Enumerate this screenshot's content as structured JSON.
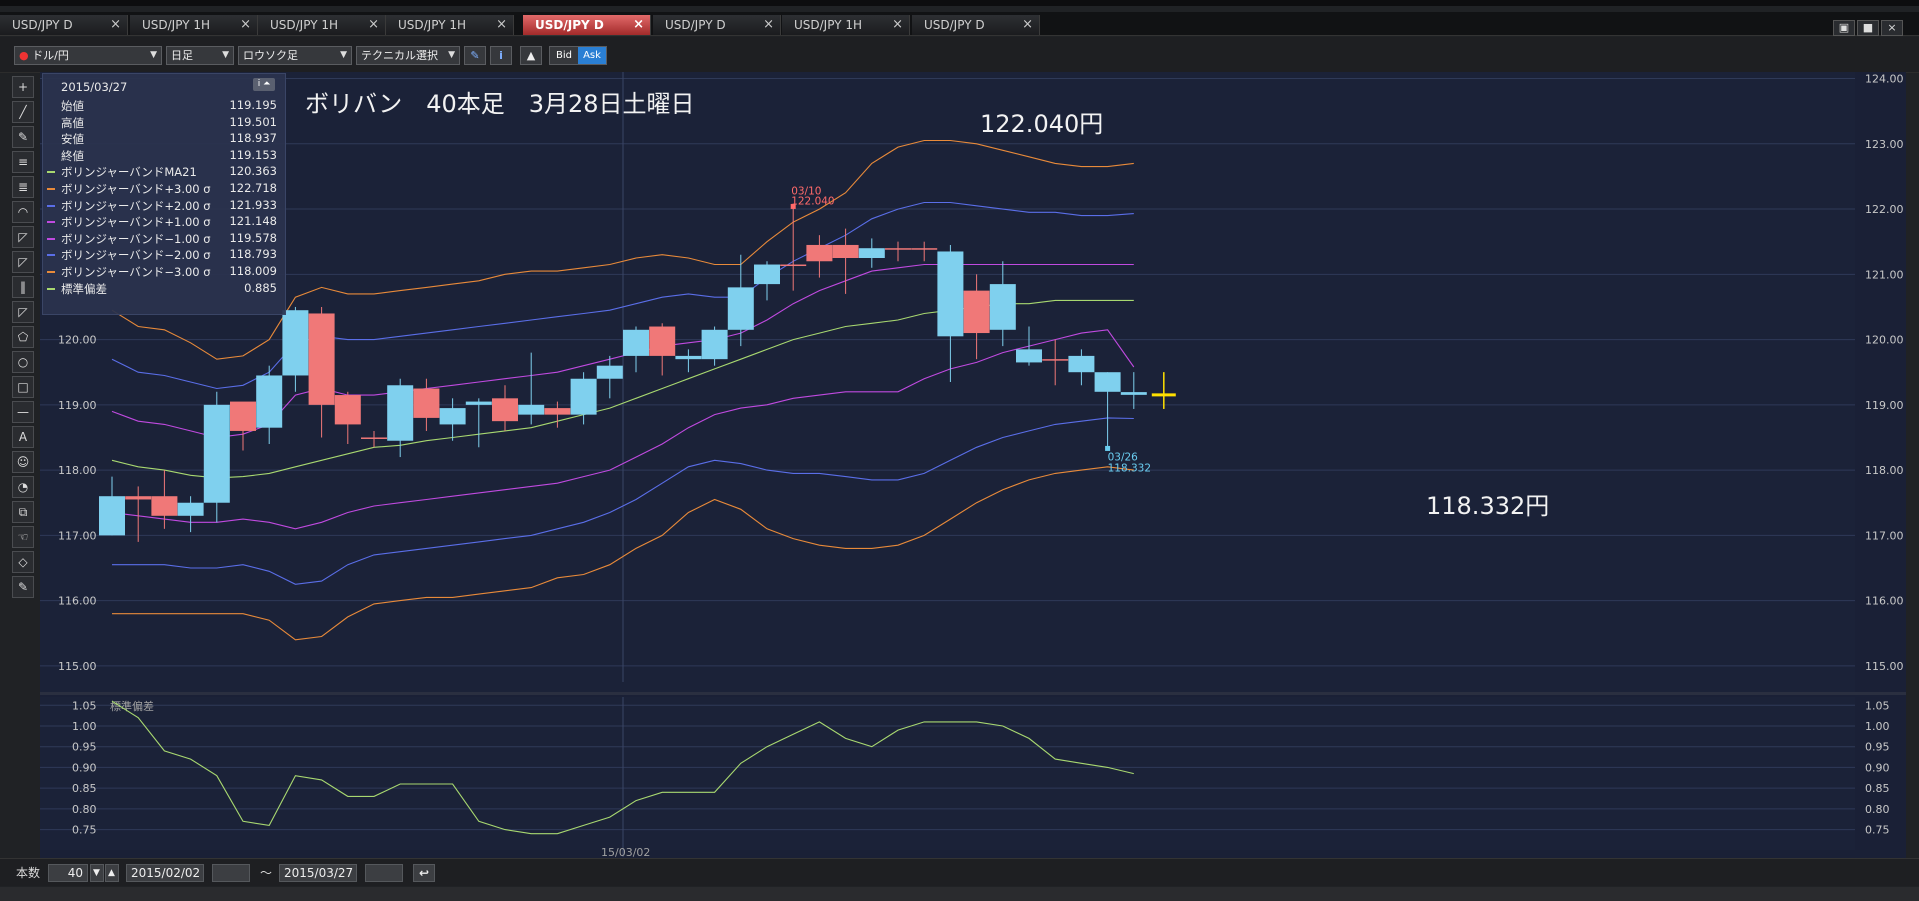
{
  "tabs": [
    {
      "label": "USD/JPY D",
      "active": false
    },
    {
      "label": "USD/JPY 1H",
      "active": false
    },
    {
      "label": "USD/JPY 1H",
      "active": false
    },
    {
      "label": "USD/JPY 1H",
      "active": false
    },
    {
      "label": "USD/JPY D",
      "active": true
    },
    {
      "label": "USD/JPY D",
      "active": false
    },
    {
      "label": "USD/JPY 1H",
      "active": false
    },
    {
      "label": "USD/JPY D",
      "active": false
    }
  ],
  "tab_close_symbol": "×",
  "window_buttons": [
    "▣",
    "■",
    "×"
  ],
  "toolbar": {
    "currency_pair": "ドル/円",
    "timeframe": "日足",
    "chart_style": "ロウソク足",
    "technical_select": "テクニカル選択",
    "bid_label": "Bid",
    "ask_label": "Ask",
    "pencil_icon": "✎",
    "info_icon": "i",
    "mountain_icon": "▲"
  },
  "left_tools": [
    "+",
    "╱",
    "✎",
    "≡",
    "≣",
    "◠",
    "◸",
    "◸",
    "‖",
    "◸",
    "⬠",
    "○",
    "□",
    "—",
    "A",
    "☺",
    "◔",
    "⧉",
    "☜",
    "◇",
    "✎"
  ],
  "info_panel": {
    "date": "2015/03/27",
    "button": "i ⏶",
    "rows": [
      {
        "label": "始値",
        "value": "119.195",
        "color": ""
      },
      {
        "label": "高値",
        "value": "119.501",
        "color": ""
      },
      {
        "label": "安値",
        "value": "118.937",
        "color": ""
      },
      {
        "label": "終値",
        "value": "119.153",
        "color": ""
      },
      {
        "label": "ボリンジャーバンドMA21",
        "value": "120.363",
        "color": "#a8d870"
      },
      {
        "label": "ボリンジャーバンド+3.00 σ",
        "value": "122.718",
        "color": "#e88a3a"
      },
      {
        "label": "ボリンジャーバンド+2.00 σ",
        "value": "121.933",
        "color": "#5a6ee8"
      },
      {
        "label": "ボリンジャーバンド+1.00 σ",
        "value": "121.148",
        "color": "#c04ae0"
      },
      {
        "label": "ボリンジャーバンド−1.00 σ",
        "value": "119.578",
        "color": "#c04ae0"
      },
      {
        "label": "ボリンジャーバンド−2.00 σ",
        "value": "118.793",
        "color": "#5a6ee8"
      },
      {
        "label": "ボリンジャーバンド−3.00 σ",
        "value": "118.009",
        "color": "#e88a3a"
      },
      {
        "label": "標準偏差",
        "value": "0.885",
        "color": "#a8d870"
      }
    ]
  },
  "chart_data": {
    "type": "candlestick",
    "title": "ボリバン　40本足　3月28日土曜日",
    "ylim": [
      114.6,
      124.1
    ],
    "yticks": [
      "124.00",
      "123.00",
      "122.00",
      "121.00",
      "120.00",
      "119.00",
      "118.00",
      "117.00",
      "116.00",
      "115.00"
    ],
    "candles": [
      {
        "o": 117.6,
        "h": 117.9,
        "l": 117.0,
        "c": 117.0
      },
      {
        "o": 117.55,
        "h": 117.75,
        "l": 116.9,
        "c": 117.6
      },
      {
        "o": 117.3,
        "h": 118.0,
        "l": 117.1,
        "c": 117.6
      },
      {
        "o": 117.5,
        "h": 117.6,
        "l": 117.05,
        "c": 117.3
      },
      {
        "o": 119.0,
        "h": 119.2,
        "l": 117.2,
        "c": 117.5
      },
      {
        "o": 118.6,
        "h": 119.0,
        "l": 118.3,
        "c": 119.05
      },
      {
        "o": 119.45,
        "h": 119.6,
        "l": 118.4,
        "c": 118.65
      },
      {
        "o": 120.45,
        "h": 120.5,
        "l": 119.2,
        "c": 119.45
      },
      {
        "o": 119.0,
        "h": 120.5,
        "l": 118.5,
        "c": 120.4
      },
      {
        "o": 118.7,
        "h": 119.2,
        "l": 118.4,
        "c": 119.15
      },
      {
        "o": 118.5,
        "h": 118.6,
        "l": 118.35,
        "c": 118.5
      },
      {
        "o": 119.3,
        "h": 119.4,
        "l": 118.2,
        "c": 118.45
      },
      {
        "o": 118.8,
        "h": 119.4,
        "l": 118.6,
        "c": 119.25
      },
      {
        "o": 118.95,
        "h": 119.1,
        "l": 118.45,
        "c": 118.7
      },
      {
        "o": 119.05,
        "h": 119.1,
        "l": 118.35,
        "c": 119.0
      },
      {
        "o": 118.75,
        "h": 119.3,
        "l": 118.6,
        "c": 119.1
      },
      {
        "o": 119.0,
        "h": 119.8,
        "l": 118.7,
        "c": 118.85
      },
      {
        "o": 118.85,
        "h": 119.05,
        "l": 118.65,
        "c": 118.95
      },
      {
        "o": 119.4,
        "h": 119.5,
        "l": 118.7,
        "c": 118.85
      },
      {
        "o": 119.6,
        "h": 119.75,
        "l": 119.1,
        "c": 119.4
      },
      {
        "o": 120.15,
        "h": 120.2,
        "l": 119.5,
        "c": 119.75
      },
      {
        "o": 119.75,
        "h": 120.25,
        "l": 119.45,
        "c": 120.2
      },
      {
        "o": 119.75,
        "h": 119.85,
        "l": 119.5,
        "c": 119.7
      },
      {
        "o": 120.15,
        "h": 120.2,
        "l": 119.6,
        "c": 119.7
      },
      {
        "o": 120.8,
        "h": 121.3,
        "l": 119.9,
        "c": 120.15
      },
      {
        "o": 121.15,
        "h": 121.2,
        "l": 120.6,
        "c": 120.85
      },
      {
        "o": 121.15,
        "h": 122.04,
        "l": 120.75,
        "c": 121.15
      },
      {
        "o": 121.2,
        "h": 121.6,
        "l": 120.95,
        "c": 121.45
      },
      {
        "o": 121.25,
        "h": 121.7,
        "l": 120.7,
        "c": 121.45
      },
      {
        "o": 121.4,
        "h": 121.55,
        "l": 121.1,
        "c": 121.25
      },
      {
        "o": 121.4,
        "h": 121.5,
        "l": 121.2,
        "c": 121.4
      },
      {
        "o": 121.4,
        "h": 121.5,
        "l": 121.2,
        "c": 121.4
      },
      {
        "o": 121.35,
        "h": 121.45,
        "l": 119.35,
        "c": 120.05
      },
      {
        "o": 120.1,
        "h": 121.0,
        "l": 119.7,
        "c": 120.75
      },
      {
        "o": 120.85,
        "h": 121.2,
        "l": 119.9,
        "c": 120.15
      },
      {
        "o": 119.85,
        "h": 120.2,
        "l": 119.6,
        "c": 119.65
      },
      {
        "o": 119.7,
        "h": 120.0,
        "l": 119.3,
        "c": 119.7
      },
      {
        "o": 119.75,
        "h": 119.85,
        "l": 119.3,
        "c": 119.5
      },
      {
        "o": 119.5,
        "h": 119.5,
        "l": 118.332,
        "c": 119.2
      },
      {
        "o": 119.195,
        "h": 119.501,
        "l": 118.937,
        "c": 119.153
      }
    ],
    "bands": [
      {
        "name": "ボリンジャーバンドMA21",
        "color": "#a8d870",
        "values": [
          118.15,
          118.05,
          118.0,
          117.92,
          117.88,
          117.9,
          117.95,
          118.05,
          118.15,
          118.25,
          118.35,
          118.38,
          118.45,
          118.5,
          118.55,
          118.6,
          118.65,
          118.75,
          118.85,
          118.95,
          119.1,
          119.25,
          119.4,
          119.55,
          119.7,
          119.85,
          120.0,
          120.1,
          120.2,
          120.25,
          120.3,
          120.4,
          120.45,
          120.5,
          120.55,
          120.55,
          120.6,
          120.6,
          120.6,
          120.6
        ]
      },
      {
        "name": "ボリンジャーバンド+3.00 σ",
        "color": "#e88a3a",
        "values": [
          120.45,
          120.2,
          120.15,
          119.95,
          119.7,
          119.75,
          120.0,
          120.65,
          120.8,
          120.7,
          120.7,
          120.75,
          120.8,
          120.85,
          120.9,
          121.0,
          121.05,
          121.05,
          121.1,
          121.15,
          121.25,
          121.3,
          121.25,
          121.15,
          121.15,
          121.5,
          121.8,
          122.0,
          122.25,
          122.7,
          122.95,
          123.05,
          123.05,
          123.0,
          122.9,
          122.8,
          122.7,
          122.65,
          122.65,
          122.7
        ]
      },
      {
        "name": "ボリンジャーバンド+2.00 σ",
        "color": "#5a6ee8",
        "values": [
          119.7,
          119.5,
          119.45,
          119.35,
          119.25,
          119.3,
          119.5,
          119.95,
          120.05,
          120.0,
          120.0,
          120.05,
          120.1,
          120.15,
          120.2,
          120.25,
          120.3,
          120.35,
          120.4,
          120.45,
          120.55,
          120.65,
          120.7,
          120.65,
          120.65,
          120.95,
          121.2,
          121.4,
          121.6,
          121.85,
          122.0,
          122.1,
          122.1,
          122.05,
          122.0,
          121.95,
          121.95,
          121.9,
          121.9,
          121.93
        ]
      },
      {
        "name": "ボリンジャーバンド+1.00 σ",
        "color": "#c04ae0",
        "values": [
          118.9,
          118.75,
          118.7,
          118.6,
          118.5,
          118.55,
          118.7,
          119.15,
          119.25,
          119.15,
          119.15,
          119.2,
          119.25,
          119.3,
          119.35,
          119.4,
          119.45,
          119.5,
          119.6,
          119.7,
          119.8,
          119.9,
          119.95,
          120.0,
          120.1,
          120.3,
          120.55,
          120.75,
          120.9,
          121.05,
          121.1,
          121.15,
          121.15,
          121.15,
          121.15,
          121.15,
          121.15,
          121.15,
          121.15,
          121.15
        ]
      },
      {
        "name": "ボリンジャーバンド−1.00 σ",
        "color": "#c04ae0",
        "values": [
          117.35,
          117.3,
          117.25,
          117.2,
          117.2,
          117.25,
          117.2,
          117.1,
          117.2,
          117.35,
          117.45,
          117.5,
          117.55,
          117.6,
          117.65,
          117.7,
          117.75,
          117.8,
          117.9,
          118.0,
          118.2,
          118.4,
          118.65,
          118.85,
          118.95,
          119.0,
          119.1,
          119.15,
          119.2,
          119.2,
          119.2,
          119.4,
          119.55,
          119.65,
          119.8,
          119.9,
          120.0,
          120.1,
          120.15,
          119.58
        ]
      },
      {
        "name": "ボリンジャーバンド−2.00 σ",
        "color": "#5a6ee8",
        "values": [
          116.55,
          116.55,
          116.55,
          116.5,
          116.5,
          116.55,
          116.45,
          116.25,
          116.3,
          116.55,
          116.7,
          116.75,
          116.8,
          116.85,
          116.9,
          116.95,
          117.0,
          117.1,
          117.2,
          117.35,
          117.55,
          117.8,
          118.05,
          118.15,
          118.1,
          118.0,
          117.95,
          117.95,
          117.9,
          117.85,
          117.85,
          117.95,
          118.15,
          118.35,
          118.5,
          118.6,
          118.7,
          118.75,
          118.8,
          118.79
        ]
      },
      {
        "name": "ボリンジャーバンド−3.00 σ",
        "color": "#e88a3a",
        "values": [
          115.8,
          115.8,
          115.8,
          115.8,
          115.8,
          115.8,
          115.7,
          115.4,
          115.45,
          115.75,
          115.95,
          116.0,
          116.05,
          116.05,
          116.1,
          116.15,
          116.2,
          116.35,
          116.4,
          116.55,
          116.8,
          117.0,
          117.35,
          117.55,
          117.4,
          117.1,
          116.95,
          116.85,
          116.8,
          116.8,
          116.85,
          117.0,
          117.25,
          117.5,
          117.7,
          117.85,
          117.95,
          118.0,
          118.05,
          118.0
        ]
      }
    ],
    "annotations": [
      {
        "text": "122.040円",
        "date": "03/10",
        "price": "122.040",
        "color": "#ff6a6a"
      },
      {
        "text": "118.332円",
        "date": "03/26",
        "price": "118.332",
        "color": "#6acdf0"
      }
    ],
    "subchart": {
      "title": "標準偏差",
      "ylim": [
        0.72,
        1.07
      ],
      "yticks": [
        "1.05",
        "1.00",
        "0.95",
        "0.90",
        "0.85",
        "0.80",
        "0.75"
      ],
      "values": [
        1.06,
        1.02,
        0.94,
        0.92,
        0.88,
        0.77,
        0.76,
        0.88,
        0.87,
        0.83,
        0.83,
        0.86,
        0.86,
        0.86,
        0.77,
        0.75,
        0.74,
        0.74,
        0.76,
        0.78,
        0.82,
        0.84,
        0.84,
        0.84,
        0.91,
        0.95,
        0.98,
        1.01,
        0.97,
        0.95,
        0.99,
        1.01,
        1.01,
        1.01,
        1.0,
        0.97,
        0.92,
        0.91,
        0.9,
        0.885
      ]
    },
    "xlabel_date": "15/03/02"
  },
  "bottom": {
    "count_label": "本数",
    "count_value": "40",
    "from_date": "2015/02/02",
    "tilde": "〜",
    "to_date": "2015/03/27",
    "apply_icon": "↩"
  }
}
